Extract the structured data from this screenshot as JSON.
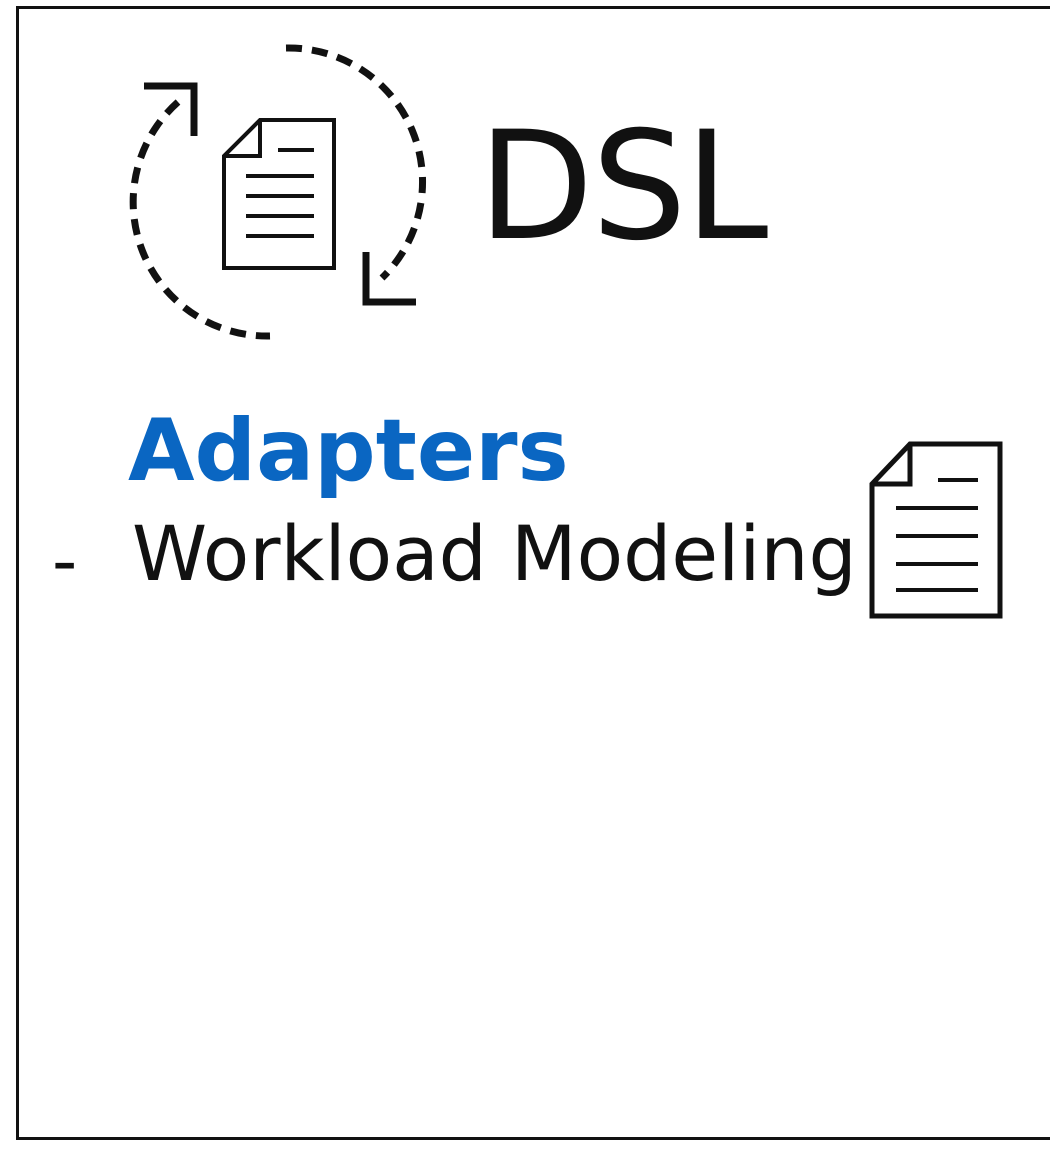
{
  "title": "DSL",
  "section": {
    "heading": "Adapters",
    "items": [
      {
        "bullet": "-",
        "label": "Workload  Modeling"
      }
    ]
  },
  "icons": {
    "cycle": "document-refresh-icon",
    "item": "document-icon"
  },
  "colors": {
    "heading": "#0a66c2",
    "text": "#111111"
  }
}
